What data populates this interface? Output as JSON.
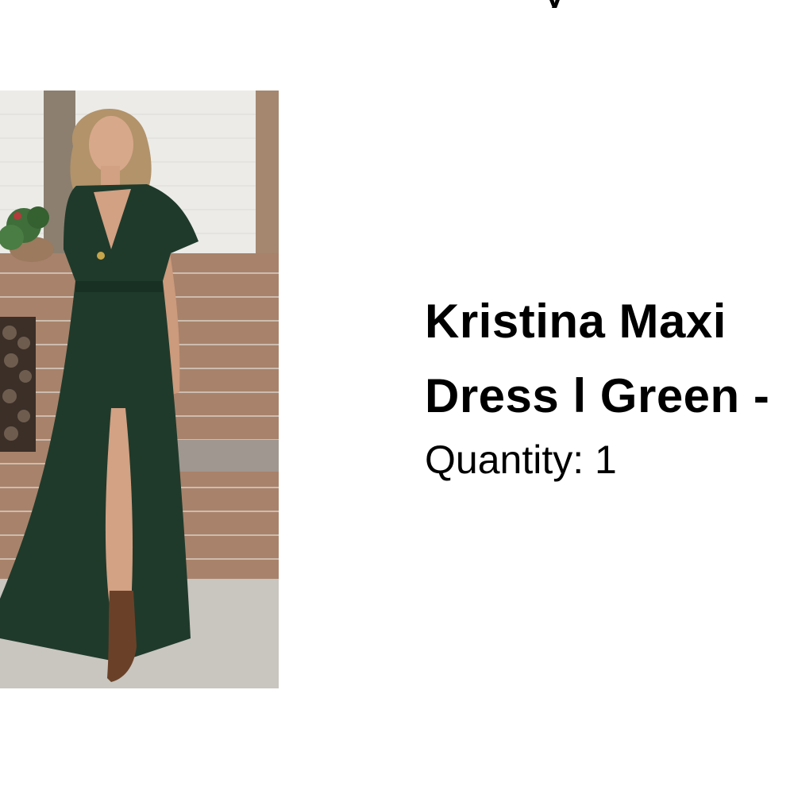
{
  "header": {
    "partial_text": "y"
  },
  "product": {
    "image_alt": "Woman wearing green maxi dress with brown ankle boots",
    "title_line1": "Kristina Maxi",
    "title_line2": "Dress l Green -",
    "quantity_label": "Quantity: 1"
  },
  "colors": {
    "dress": "#1f3a2b",
    "boots": "#6a4128",
    "brick": "#a8826b",
    "wall": "#eeeeec"
  }
}
